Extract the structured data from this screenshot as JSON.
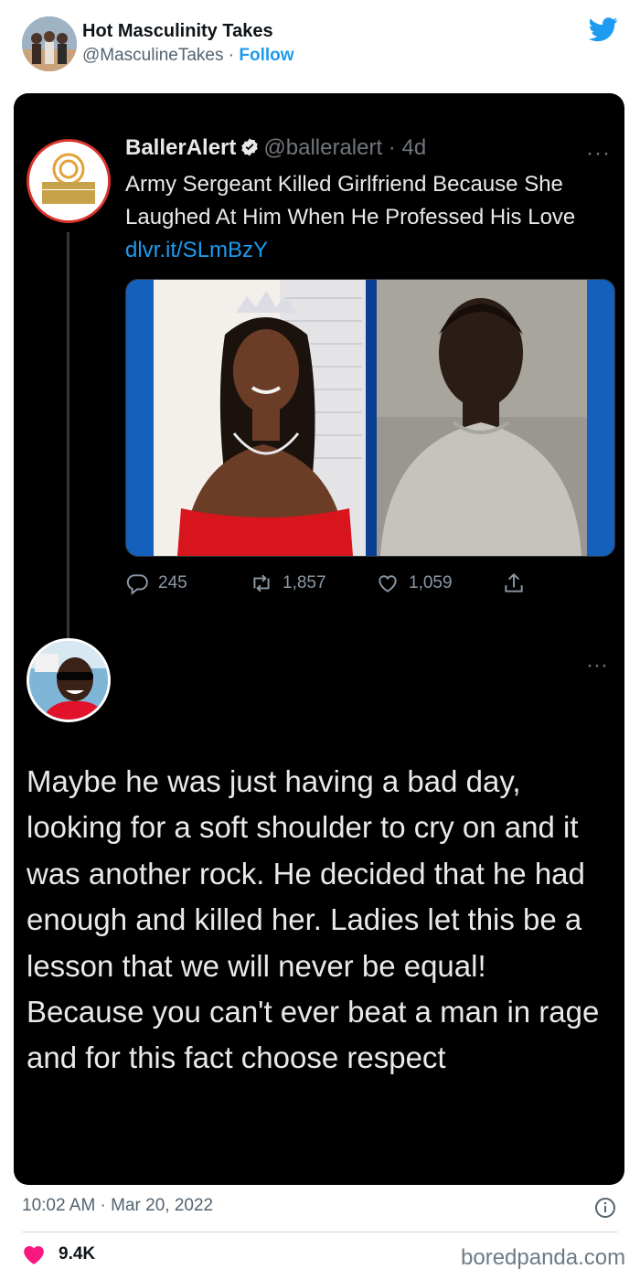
{
  "outer": {
    "display_name": "Hot Masculinity Takes",
    "handle": "@MasculineTakes",
    "separator": " · ",
    "follow_label": "Follow"
  },
  "quoted": {
    "display_name": "BallerAlert",
    "handle": "@balleralert",
    "separator": " · ",
    "age": "4d",
    "more": "···",
    "text": "Army Sergeant Killed Girlfriend Because She Laughed At Him When He Professed His Love ",
    "link": "dlvr.it/SLmBzY",
    "avatar_logo": "BALLER ALERT",
    "stats": {
      "replies": "245",
      "retweets": "1,857",
      "likes": "1,059"
    }
  },
  "reply": {
    "more": "···",
    "text": "Maybe he was just having a bad day, looking for a soft shoulder to cry on and it was another rock. He decided that he had enough and killed her. Ladies let this be a lesson that we will never be equal! Because you can't ever beat a man in rage and for this fact choose respect"
  },
  "footer": {
    "timestamp": "10:02 AM · Mar 20, 2022",
    "likes": "9.4K",
    "watermark": "boredpanda.com"
  },
  "colors": {
    "accent": "#1d9bf0",
    "heart": "#f91880",
    "card_bg": "#000000"
  },
  "icons": [
    "twitter-bird-icon",
    "verified-badge-icon",
    "reply-icon",
    "retweet-icon",
    "like-icon",
    "share-icon",
    "info-icon",
    "heart-icon"
  ]
}
